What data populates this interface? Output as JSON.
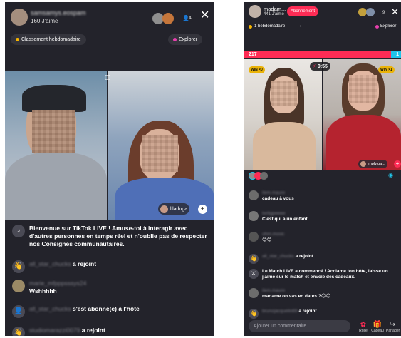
{
  "left": {
    "host": {
      "name": "samsamys.eospam",
      "likes": "160 J'aime"
    },
    "viewer_count": "4",
    "weekly_ranking": "Classement hebdomadaire",
    "explore": "Explorer",
    "guest_name": "liladuga",
    "chat": [
      {
        "user": "",
        "text": "Bienvenue sur TikTok LIVE ! Amuse-toi à interagir avec d'autres personnes en temps réel et n'oublie pas de respecter nos Consignes communautaires."
      },
      {
        "user": "all_star_chucks",
        "text": "a rejoint"
      },
      {
        "user": "marie_mfpppsssys24",
        "text": "Wshhhhh"
      },
      {
        "user": "all_star_chucks",
        "text": "s'est abonné(e) à l'hôte"
      },
      {
        "user": "studiomarazzi0079",
        "text": "a rejoint"
      }
    ]
  },
  "right": {
    "host": {
      "name": "madam...",
      "likes": "441 J'aime"
    },
    "follow_button": "Abonnement",
    "viewer_count": "9",
    "weekly_ranking": "1 hebdomadaire",
    "explore": "Explorer",
    "score_left": "217",
    "score_right": "1",
    "timer": "0:55",
    "win_left": "WIN ×0",
    "win_right": "WIN ×1",
    "guest_name": "jmply.ga...",
    "chat": [
      {
        "user": "ilem.maure",
        "text": "cadeau à vous"
      },
      {
        "user": "tortigpeeee",
        "text": "C'est qui a un enfant"
      },
      {
        "user": "ohm.mosic",
        "text": "😊😊"
      },
      {
        "user": "all_star_chucks",
        "text": "a rejoint"
      },
      {
        "user": "",
        "text": "Le Match LIVE a commencé ! Acclame ton hôte, laisse un j'aime sur le match et envoie des cadeaux."
      },
      {
        "user": "ilem.maure",
        "text": "madame on vas en dates ?😊😊"
      },
      {
        "user": "brunojacquelin69",
        "text": "a rejoint"
      }
    ],
    "comment_placeholder": "Ajouter un commentaire...",
    "bottom_buttons": [
      "Rose",
      "Cadeau",
      "Partager"
    ]
  },
  "colors": {
    "accent": "#fe2c55",
    "cyan": "#20c5e9",
    "panel": "#23232b"
  }
}
